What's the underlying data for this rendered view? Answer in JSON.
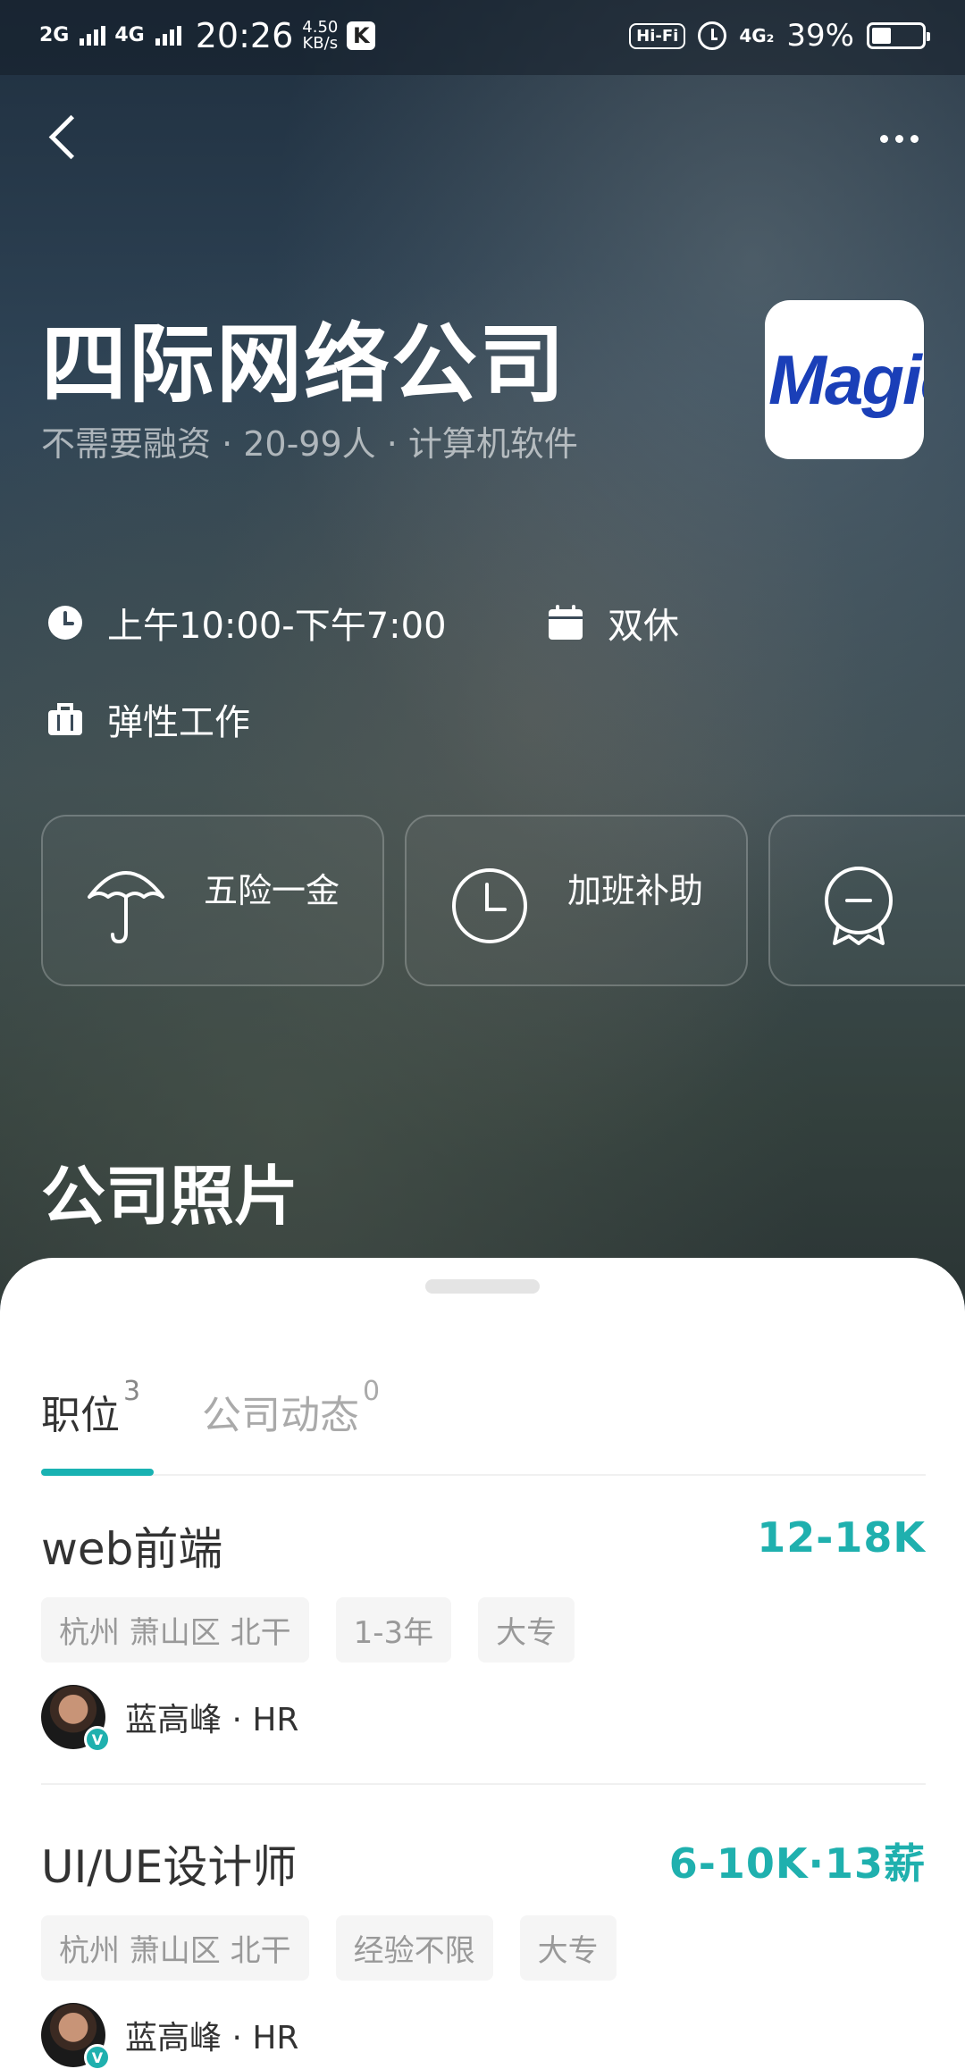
{
  "status_bar": {
    "signal_left": "2G",
    "signal_right": "4G",
    "time": "20:26",
    "speed_value": "4.50",
    "speed_unit": "KB/s",
    "app_badge": "K",
    "hifi": "Hi-Fi",
    "network": "4G₂",
    "battery_text": "39%",
    "battery_level": 0.39
  },
  "company": {
    "name": "四际网络公司",
    "meta": "不需要融资 · 20-99人 · 计算机软件",
    "logo_text": "Magic"
  },
  "info": {
    "hours": "上午10:00-下午7:00",
    "weekend": "双休",
    "flex": "弹性工作"
  },
  "benefits": [
    {
      "label": "五险一金",
      "icon": "umbrella-icon"
    },
    {
      "label": "加班补助",
      "icon": "clock-icon"
    },
    {
      "label": "",
      "icon": "medal-icon"
    }
  ],
  "section_title": "公司照片",
  "tabs": [
    {
      "label": "职位",
      "count": "3",
      "active": true
    },
    {
      "label": "公司动态",
      "count": "0",
      "active": false
    }
  ],
  "jobs": [
    {
      "title": "web前端",
      "salary": "12-18K",
      "tags": [
        "杭州 萧山区 北干",
        "1-3年",
        "大专"
      ],
      "recruiter": "蓝高峰 · HR"
    },
    {
      "title": "UI/UE设计师",
      "salary": "6-10K·13薪",
      "tags": [
        "杭州 萧山区 北干",
        "经验不限",
        "大专"
      ],
      "recruiter": "蓝高峰 · HR"
    }
  ],
  "colors": {
    "accent": "#1fb0ae",
    "logo_blue": "#1a3fb8"
  }
}
